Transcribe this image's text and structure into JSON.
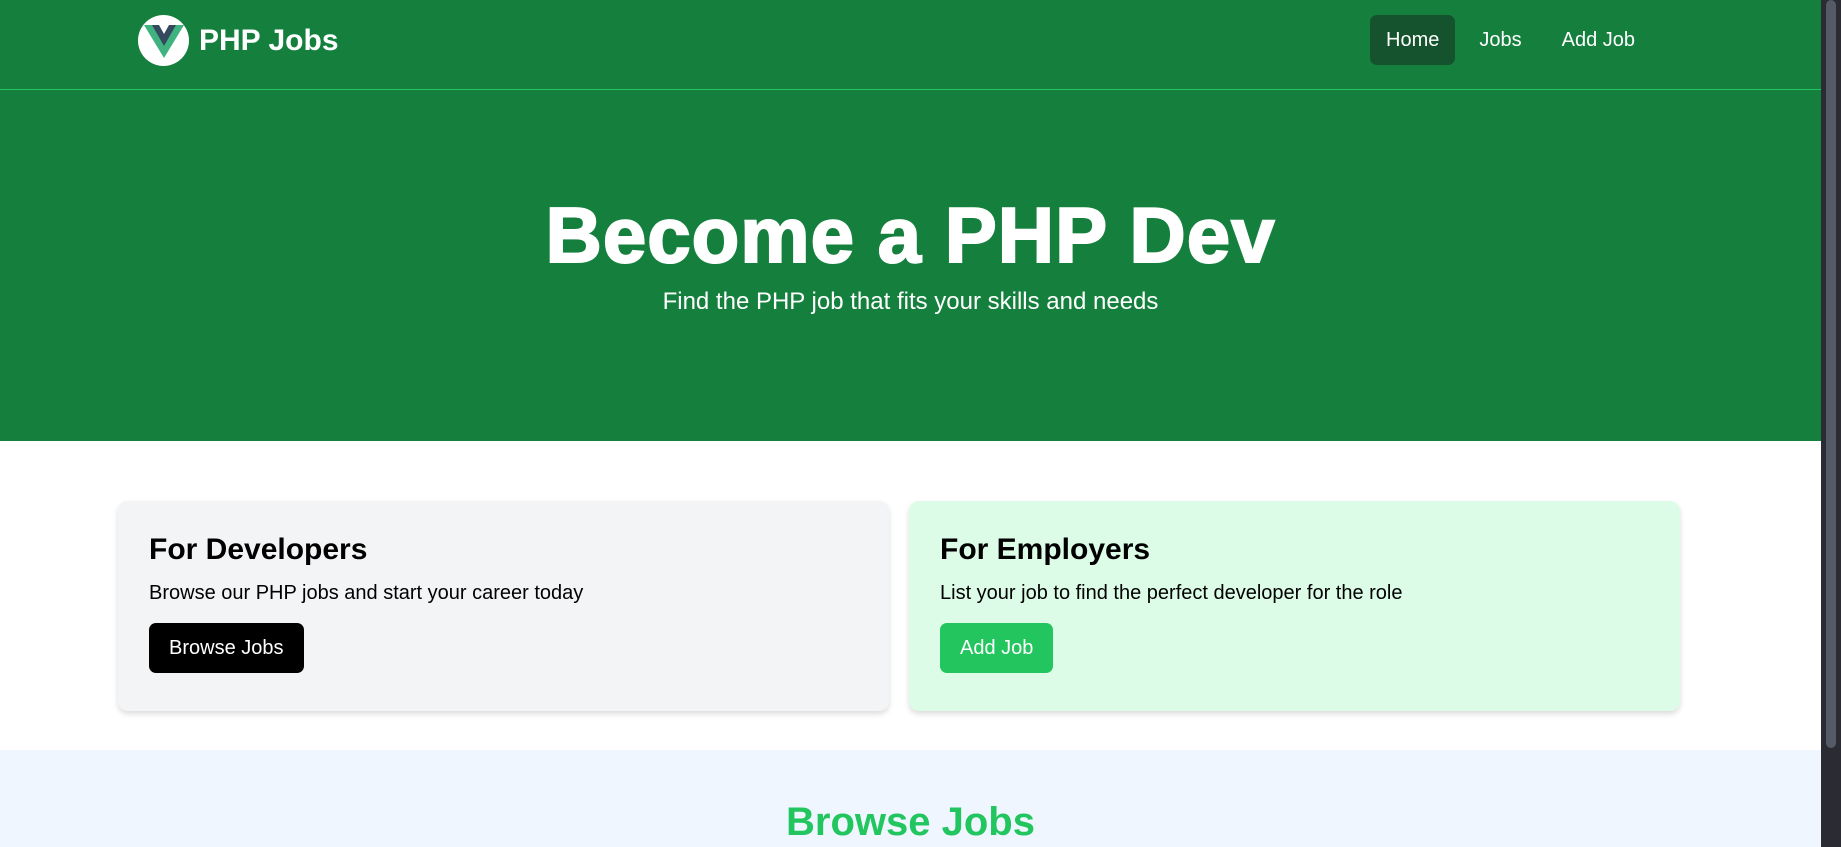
{
  "navbar": {
    "brand_name": "PHP Jobs",
    "logo_icon": "vue-logo-icon",
    "links": [
      {
        "label": "Home",
        "active": true
      },
      {
        "label": "Jobs",
        "active": false
      },
      {
        "label": "Add Job",
        "active": false
      }
    ]
  },
  "hero": {
    "title": "Become a PHP Dev",
    "subtitle": "Find the PHP job that fits your skills and needs"
  },
  "cards": {
    "developers": {
      "title": "For Developers",
      "text": "Browse our PHP jobs and start your career today",
      "button_label": "Browse Jobs"
    },
    "employers": {
      "title": "For Employers",
      "text": "List your job to find the perfect developer for the role",
      "button_label": "Add Job"
    }
  },
  "browse_section": {
    "title": "Browse Jobs"
  },
  "colors": {
    "primary_green": "#15803d",
    "active_nav": "#14532d",
    "accent_green": "#22c55e",
    "employer_card": "#dcfce7",
    "developer_card": "#f3f4f6",
    "browse_bg": "#eff6ff"
  }
}
